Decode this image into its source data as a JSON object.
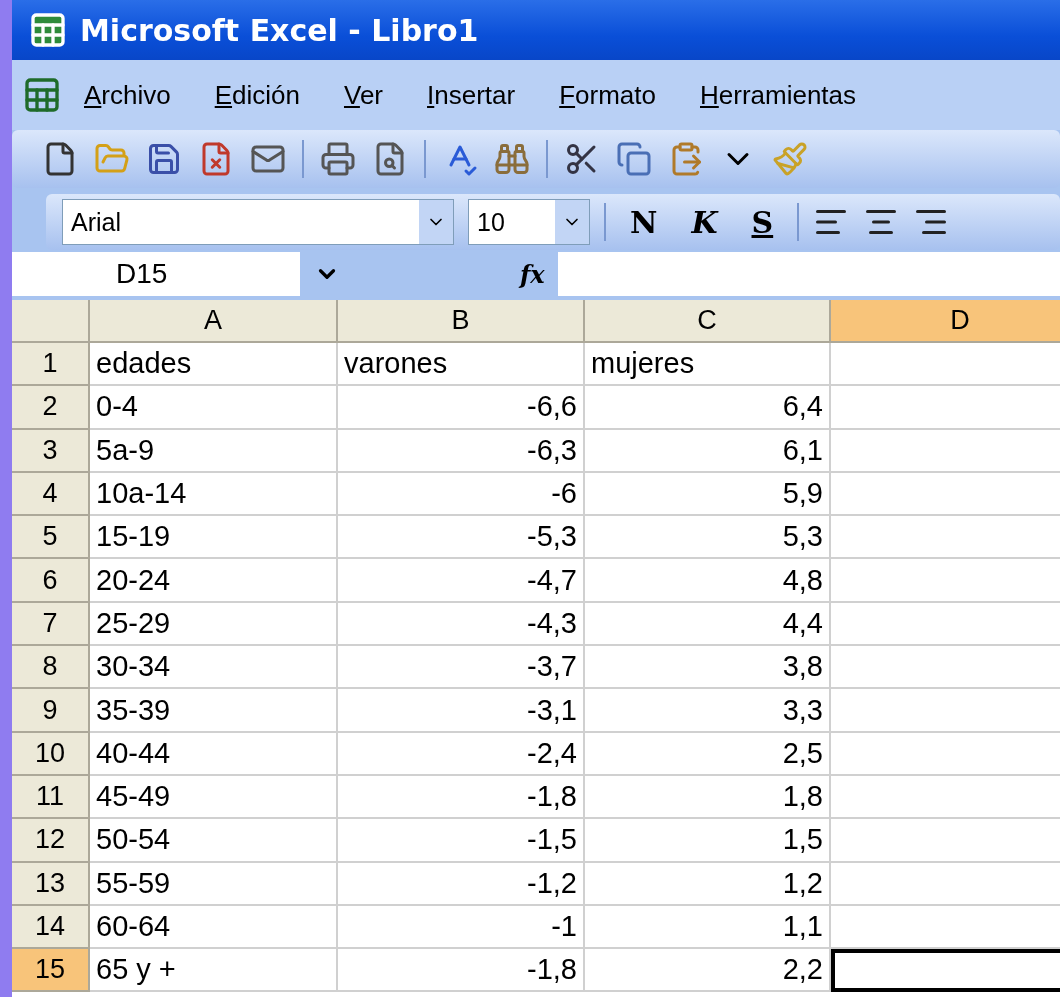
{
  "window": {
    "title": "Microsoft Excel - Libro1"
  },
  "menu": [
    {
      "key": "A",
      "rest": "rchivo"
    },
    {
      "key": "E",
      "rest": "dición"
    },
    {
      "key": "V",
      "rest": "er"
    },
    {
      "key": "I",
      "rest": "nsertar"
    },
    {
      "key": "F",
      "rest": "ormato"
    },
    {
      "key": "H",
      "rest": "erramientas"
    }
  ],
  "format_toolbar": {
    "font": "Arial",
    "size": "10",
    "bold": "N",
    "italic": "K",
    "underline": "S"
  },
  "formula_bar": {
    "name_box": "D15",
    "fx": "fx"
  },
  "sheet": {
    "columns": [
      {
        "label": "A",
        "selected": false
      },
      {
        "label": "B",
        "selected": false
      },
      {
        "label": "C",
        "selected": false
      },
      {
        "label": "D",
        "selected": true
      }
    ],
    "rows": [
      {
        "header": "1",
        "selected": false,
        "cells": [
          {
            "text": "edades",
            "numeric": false
          },
          {
            "text": "varones",
            "numeric": false
          },
          {
            "text": "mujeres",
            "numeric": false
          }
        ]
      },
      {
        "header": "2",
        "selected": false,
        "cells": [
          {
            "text": "0-4",
            "numeric": false
          },
          {
            "text": "-6,6",
            "numeric": true
          },
          {
            "text": "6,4",
            "numeric": true
          }
        ]
      },
      {
        "header": "3",
        "selected": false,
        "cells": [
          {
            "text": "5a-9",
            "numeric": false
          },
          {
            "text": "-6,3",
            "numeric": true
          },
          {
            "text": "6,1",
            "numeric": true
          }
        ]
      },
      {
        "header": "4",
        "selected": false,
        "cells": [
          {
            "text": "10a-14",
            "numeric": false
          },
          {
            "text": "-6",
            "numeric": true
          },
          {
            "text": "5,9",
            "numeric": true
          }
        ]
      },
      {
        "header": "5",
        "selected": false,
        "cells": [
          {
            "text": "15-19",
            "numeric": false
          },
          {
            "text": "-5,3",
            "numeric": true
          },
          {
            "text": "5,3",
            "numeric": true
          }
        ]
      },
      {
        "header": "6",
        "selected": false,
        "cells": [
          {
            "text": "20-24",
            "numeric": false
          },
          {
            "text": "-4,7",
            "numeric": true
          },
          {
            "text": "4,8",
            "numeric": true
          }
        ]
      },
      {
        "header": "7",
        "selected": false,
        "cells": [
          {
            "text": "25-29",
            "numeric": false
          },
          {
            "text": "-4,3",
            "numeric": true
          },
          {
            "text": "4,4",
            "numeric": true
          }
        ]
      },
      {
        "header": "8",
        "selected": false,
        "cells": [
          {
            "text": "30-34",
            "numeric": false
          },
          {
            "text": "-3,7",
            "numeric": true
          },
          {
            "text": "3,8",
            "numeric": true
          }
        ]
      },
      {
        "header": "9",
        "selected": false,
        "cells": [
          {
            "text": "35-39",
            "numeric": false
          },
          {
            "text": "-3,1",
            "numeric": true
          },
          {
            "text": "3,3",
            "numeric": true
          }
        ]
      },
      {
        "header": "10",
        "selected": false,
        "cells": [
          {
            "text": "40-44",
            "numeric": false
          },
          {
            "text": "-2,4",
            "numeric": true
          },
          {
            "text": "2,5",
            "numeric": true
          }
        ]
      },
      {
        "header": "11",
        "selected": false,
        "cells": [
          {
            "text": "45-49",
            "numeric": false
          },
          {
            "text": "-1,8",
            "numeric": true
          },
          {
            "text": "1,8",
            "numeric": true
          }
        ]
      },
      {
        "header": "12",
        "selected": false,
        "cells": [
          {
            "text": "50-54",
            "numeric": false
          },
          {
            "text": "-1,5",
            "numeric": true
          },
          {
            "text": "1,5",
            "numeric": true
          }
        ]
      },
      {
        "header": "13",
        "selected": false,
        "cells": [
          {
            "text": "55-59",
            "numeric": false
          },
          {
            "text": "-1,2",
            "numeric": true
          },
          {
            "text": "1,2",
            "numeric": true
          }
        ]
      },
      {
        "header": "14",
        "selected": false,
        "cells": [
          {
            "text": "60-64",
            "numeric": false
          },
          {
            "text": "-1",
            "numeric": true
          },
          {
            "text": "1,1",
            "numeric": true
          }
        ]
      },
      {
        "header": "15",
        "selected": true,
        "cells": [
          {
            "text": "65 y +",
            "numeric": false
          },
          {
            "text": "-1,8",
            "numeric": true
          },
          {
            "text": "2,2",
            "numeric": true
          }
        ]
      }
    ]
  }
}
